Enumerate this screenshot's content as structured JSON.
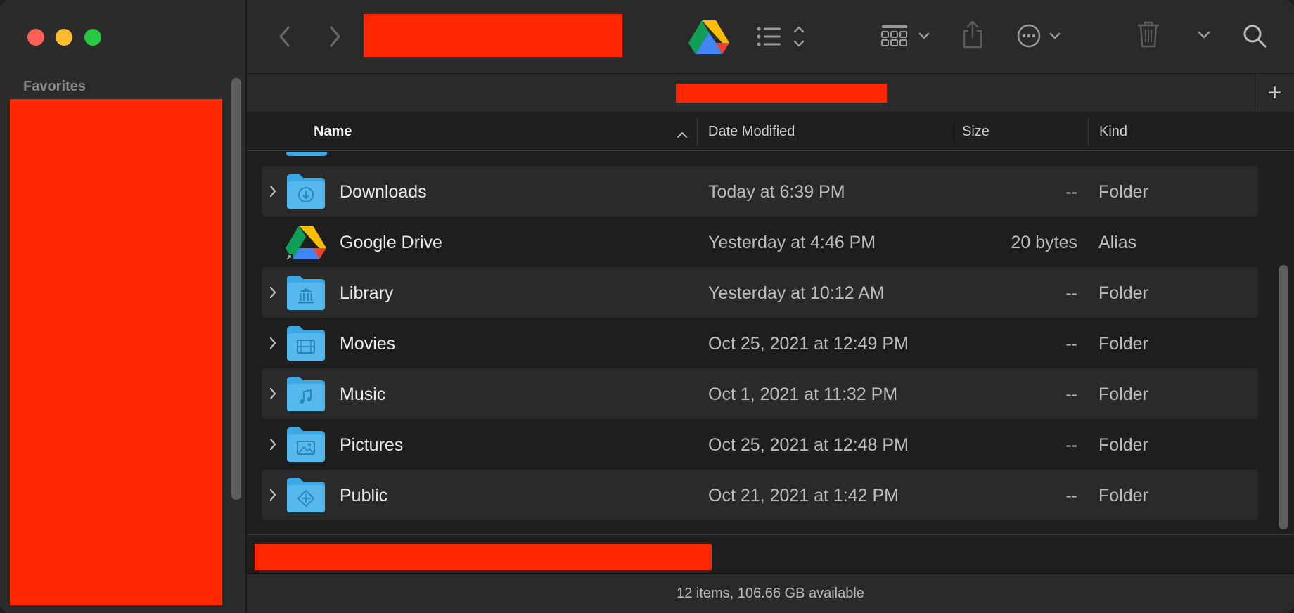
{
  "window": {
    "controls": [
      "close",
      "minimize",
      "zoom"
    ]
  },
  "sidebar": {
    "heading": "Favorites"
  },
  "toolbar": {
    "back_icon": "chevron-left-icon",
    "forward_icon": "chevron-right-icon",
    "location_icon": "google-drive-icon",
    "view_icon": "list-view-icon",
    "group_icon": "grid-group-icon",
    "share_icon": "share-icon",
    "more_icon": "ellipsis-circle-icon",
    "trash_icon": "trash-icon",
    "dropdown_icon": "chevron-down-icon",
    "search_icon": "search-icon",
    "new_tab_label": "+"
  },
  "columns": {
    "name": "Name",
    "date": "Date Modified",
    "size": "Size",
    "kind": "Kind"
  },
  "files": [
    {
      "name": "Downloads",
      "date": "Today at 6:39 PM",
      "size": "--",
      "kind": "Folder",
      "icon": "downloads-folder-icon",
      "expandable": true
    },
    {
      "name": "Google Drive",
      "date": "Yesterday at 4:46 PM",
      "size": "20 bytes",
      "kind": "Alias",
      "icon": "google-drive-icon",
      "expandable": false
    },
    {
      "name": "Library",
      "date": "Yesterday at 10:12 AM",
      "size": "--",
      "kind": "Folder",
      "icon": "library-folder-icon",
      "expandable": true
    },
    {
      "name": "Movies",
      "date": "Oct 25, 2021 at 12:49 PM",
      "size": "--",
      "kind": "Folder",
      "icon": "movies-folder-icon",
      "expandable": true
    },
    {
      "name": "Music",
      "date": "Oct 1, 2021 at 11:32 PM",
      "size": "--",
      "kind": "Folder",
      "icon": "music-folder-icon",
      "expandable": true
    },
    {
      "name": "Pictures",
      "date": "Oct 25, 2021 at 12:48 PM",
      "size": "--",
      "kind": "Folder",
      "icon": "pictures-folder-icon",
      "expandable": true
    },
    {
      "name": "Public",
      "date": "Oct 21, 2021 at 1:42 PM",
      "size": "--",
      "kind": "Folder",
      "icon": "public-folder-icon",
      "expandable": true
    }
  ],
  "status": {
    "text": "12 items, 106.66 GB available"
  },
  "colors": {
    "redaction": "#ff2600",
    "folder": "#3aa9e6",
    "window_bg": "#1e1e1e",
    "toolbar_bg": "#2a2a2a"
  }
}
